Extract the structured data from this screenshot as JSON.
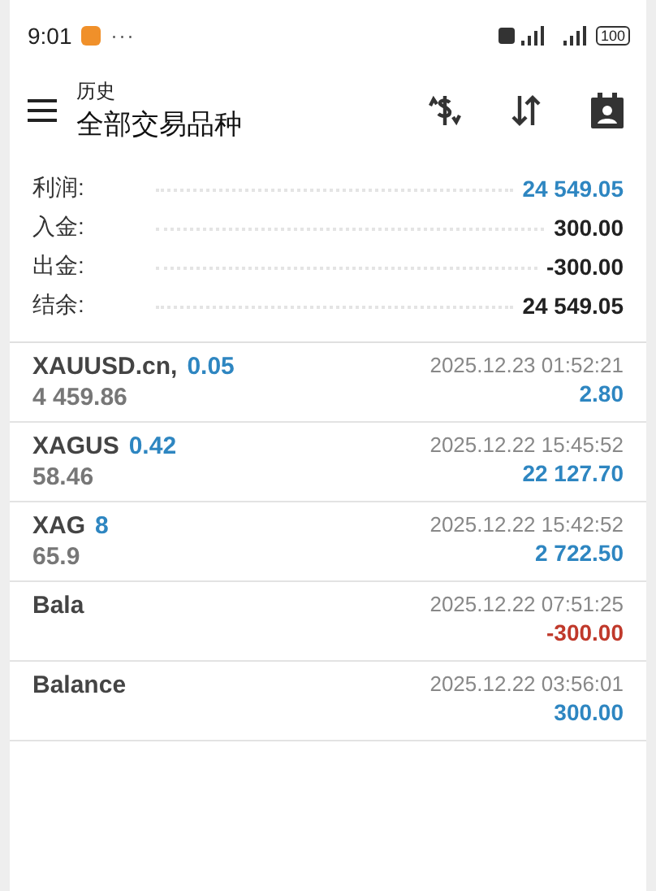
{
  "status_bar": {
    "time": "9:01",
    "more": "···",
    "battery": "100"
  },
  "header": {
    "subtitle": "历史",
    "title": "全部交易品种"
  },
  "summary": [
    {
      "label": "利润:",
      "value": "24 549.05",
      "highlight": true
    },
    {
      "label": "入金:",
      "value": "300.00",
      "highlight": false
    },
    {
      "label": "出金:",
      "value": "-300.00",
      "highlight": false
    },
    {
      "label": "结余:",
      "value": "24 549.05",
      "highlight": false
    }
  ],
  "deals": [
    {
      "symbol": "XAUUSD.cn,",
      "lot": "0.05",
      "prices": "4 459.86",
      "time": "2025.12.23 01:52:21",
      "amount": "2.80",
      "negative": false
    },
    {
      "symbol": "XAGUS",
      "lot": "0.42",
      "prices": "58.46",
      "time": "2025.12.22 15:45:52",
      "amount": "22 127.70",
      "negative": false
    },
    {
      "symbol": "XAG",
      "lot": "8",
      "prices": "65.9",
      "time": "2025.12.22 15:42:52",
      "amount": "2 722.50",
      "negative": false
    },
    {
      "symbol": "Bala",
      "time": "2025.12.22 07:51:25",
      "amount": "-300.00",
      "negative": true
    },
    {
      "symbol": "Balance",
      "time": "2025.12.22 03:56:01",
      "amount": "300.00",
      "negative": false
    }
  ]
}
